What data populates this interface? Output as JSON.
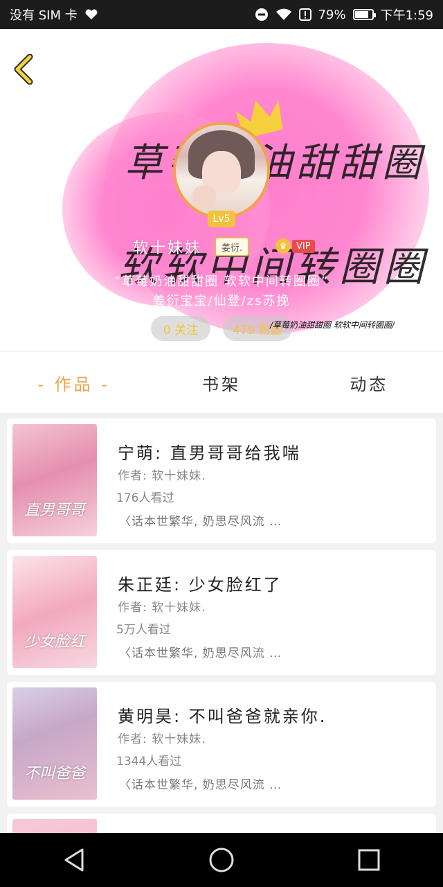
{
  "status_bar": {
    "carrier": "没有 SIM 卡",
    "battery": "79%",
    "time": "下午1:59",
    "battery_level": 0.79
  },
  "header": {
    "bg_text_line1": "草莓奶油甜甜圈",
    "bg_text_line2": "软软中间转圈圈",
    "level": "Lv5",
    "nickname": "软十妹妹",
    "name_tag": "姜衍.",
    "vip": "VIP",
    "signature_line1": "“草莓奶油甜甜圈 软软中间转圈圈”",
    "signature_line2": "姜衍宝宝/仙登/zs苏挽",
    "stat1": "0 关注",
    "stat2": "479 粉丝",
    "bg_small_text": "/草莓奶油甜甜圈 软软中间转圈圈/"
  },
  "tabs": [
    {
      "label": "- 作品 -",
      "active": true
    },
    {
      "label": "书架",
      "active": false
    },
    {
      "label": "动态",
      "active": false
    }
  ],
  "books": [
    {
      "title": "宁萌: 直男哥哥给我喘",
      "author": "作者: 软十妹妹.",
      "views": "176人看过",
      "desc": "〈话本世繁华, 奶思尽风流 …",
      "cover_text": "直男哥哥"
    },
    {
      "title": "朱正廷: 少女脸红了",
      "author": "作者: 软十妹妹.",
      "views": "5万人看过",
      "desc": "〈话本世繁华, 奶思尽风流 …",
      "cover_text": "少女脸红"
    },
    {
      "title": "黄明昊: 不叫爸爸就亲你.",
      "author": "作者: 软十妹妹.",
      "views": "1344人看过",
      "desc": "〈话本世繁华, 奶思尽风流 …",
      "cover_text": "不叫爸爸"
    }
  ],
  "colors": {
    "accent": "#f0a34a",
    "pink": "#ff86cf",
    "vip_red": "#e84b4b",
    "level_gold": "#f4c23a"
  }
}
